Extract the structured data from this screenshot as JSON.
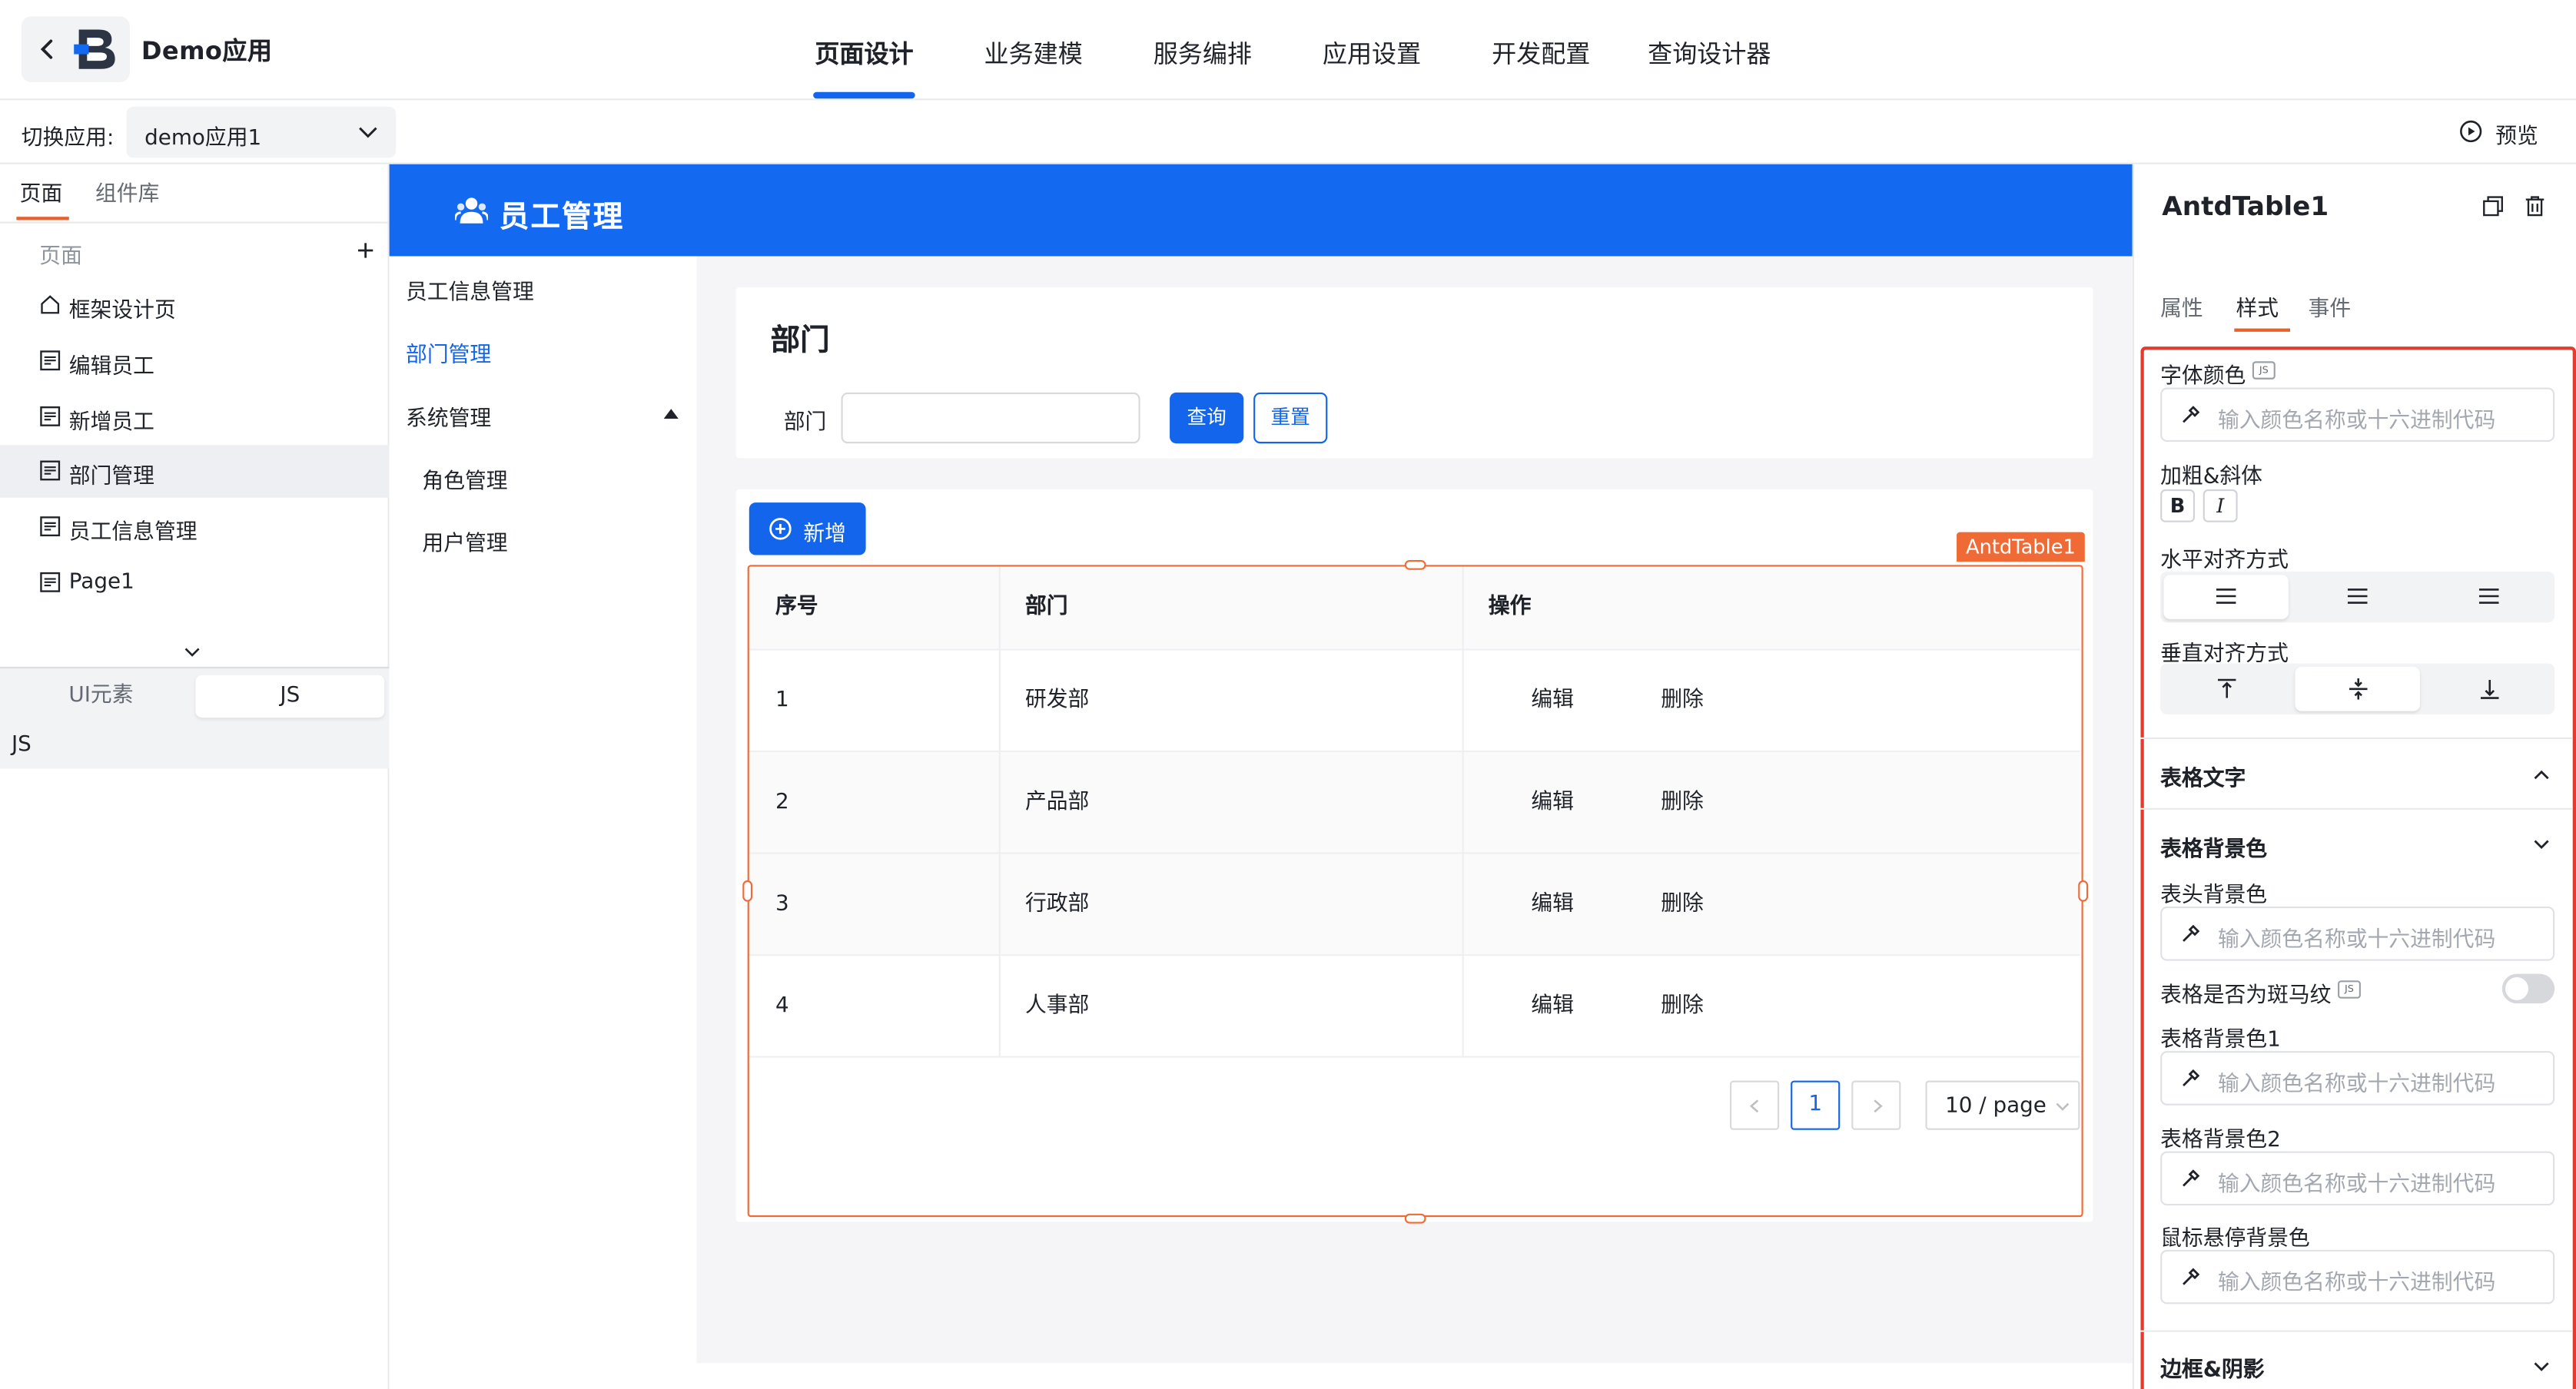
{
  "header": {
    "app_name": "Demo应用",
    "tabs": [
      "页面设计",
      "业务建模",
      "服务编排",
      "应用设置",
      "开发配置",
      "查询设计器"
    ],
    "active_tab": "页面设计",
    "switch_label": "切换应用:",
    "switch_value": "demo应用1",
    "preview_label": "预览",
    "accent": "#1366ec"
  },
  "left_panel": {
    "tabs": [
      "页面",
      "组件库"
    ],
    "section_label": "页面",
    "items": [
      {
        "label": "框架设计页",
        "icon": "home-icon"
      },
      {
        "label": "编辑员工",
        "icon": "page-icon"
      },
      {
        "label": "新增员工",
        "icon": "page-icon"
      },
      {
        "label": "部门管理",
        "icon": "page-icon",
        "selected": true
      },
      {
        "label": "员工信息管理",
        "icon": "page-icon"
      },
      {
        "label": "Page1",
        "icon": "page-icon"
      }
    ],
    "bottom_tabs": [
      "UI元素",
      "JS"
    ],
    "bottom_active": "JS",
    "bottom_content": "JS"
  },
  "canvas": {
    "app_title": "员工管理",
    "nav": [
      {
        "label": "员工信息管理"
      },
      {
        "label": "部门管理",
        "active": true
      },
      {
        "label": "系统管理"
      },
      {
        "label": "角色管理"
      },
      {
        "label": "用户管理"
      }
    ],
    "page_title": "部门",
    "search_label": "部门",
    "query_btn": "查询",
    "reset_btn": "重置",
    "add_btn": "新增",
    "component_tag": "AntdTable1",
    "table": {
      "headers": [
        "序号",
        "部门",
        "操作"
      ],
      "rows": [
        {
          "no": "1",
          "dept": "研发部",
          "edit": "编辑",
          "del": "删除"
        },
        {
          "no": "2",
          "dept": "产品部",
          "edit": "编辑",
          "del": "删除"
        },
        {
          "no": "3",
          "dept": "行政部",
          "edit": "编辑",
          "del": "删除"
        },
        {
          "no": "4",
          "dept": "人事部",
          "edit": "编辑",
          "del": "删除"
        }
      ]
    },
    "pagination": {
      "current": "1",
      "page_size": "10 / page"
    },
    "primary_color": "#1469f1",
    "selection_color": "#f06a35"
  },
  "right_panel": {
    "title": "AntdTable1",
    "tabs": [
      "属性",
      "样式",
      "事件"
    ],
    "active_tab": "样式",
    "js_badge": "JS",
    "font_color_label": "字体颜色",
    "color_placeholder": "输入颜色名称或十六进制代码",
    "bold_italic_label": "加粗&斜体",
    "bold": "B",
    "italic": "I",
    "h_align_label": "水平对齐方式",
    "v_align_label": "垂直对齐方式",
    "table_text_section": "表格文字",
    "table_bg_section": "表格背景色",
    "header_bg_label": "表头背景色",
    "zebra_label": "表格是否为斑马纹",
    "bg1_label": "表格背景色1",
    "bg2_label": "表格背景色2",
    "hover_bg_label": "鼠标悬停背景色",
    "border_section": "边框&阴影"
  }
}
